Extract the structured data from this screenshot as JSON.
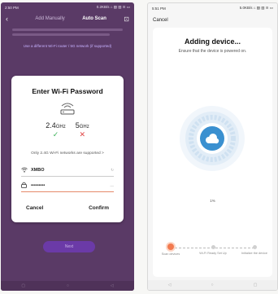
{
  "left": {
    "status": {
      "time": "2:50 PM",
      "right": "0.2KB/s ⌂ ▨ ▥ ≋ ▭"
    },
    "header": {
      "title": "Add Manually",
      "sub": "Auto Scan"
    },
    "link": "Use a different Wi-Fi router / 5G network (if supported)",
    "dialog": {
      "title": "Enter Wi-Fi Password",
      "band_24": "2.4",
      "band_24_unit": "GHz",
      "band_5": "5",
      "band_5_unit": "GHz",
      "note": "Only 2.4G Wi-Fi networks are supported >",
      "ssid": "XMBO",
      "ssid_tail": "↻",
      "password": "•••••••••",
      "cancel": "Cancel",
      "confirm": "Confirm"
    },
    "next": "Next",
    "nav": [
      "▢",
      "○",
      "◁"
    ]
  },
  "right": {
    "status": {
      "time": "5:51 PM",
      "right": "5.0KB/s ⌂ ▨ ▥ ≋ ▭"
    },
    "cancel": "Cancel",
    "title": "Adding device...",
    "subtitle": "Ensure that the device is powered on.",
    "percent": "1%",
    "steps": [
      {
        "label": "Scan devices"
      },
      {
        "label": "Wi-Fi Ready Set Up"
      },
      {
        "label": "Initialize the device"
      }
    ],
    "nav": [
      "◁",
      "○",
      "▢"
    ]
  },
  "colors": {
    "accent": "#6b3aa7",
    "progress": "#2f8ccf",
    "step_active": "#f27a4f"
  }
}
